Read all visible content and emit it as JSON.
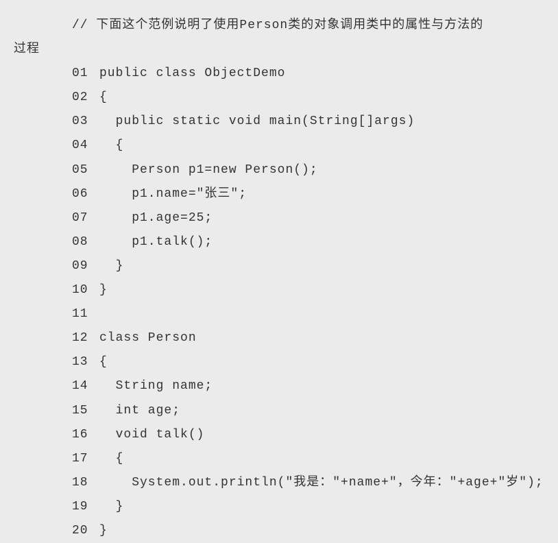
{
  "comment": {
    "line1": "// 下面这个范例说明了使用Person类的对象调用类中的属性与方法的",
    "line2": "过程"
  },
  "lines": [
    {
      "num": "01",
      "code": "public class ObjectDemo"
    },
    {
      "num": "02",
      "code": "{"
    },
    {
      "num": "",
      "code": ""
    },
    {
      "num": "03",
      "code": "  public static void main(String[]args)"
    },
    {
      "num": "04",
      "code": "  {"
    },
    {
      "num": "05",
      "code": "    Person p1=new Person();"
    },
    {
      "num": "06",
      "code": "    p1.name=\"张三\";"
    },
    {
      "num": "07",
      "code": "    p1.age=25;"
    },
    {
      "num": "08",
      "code": "    p1.talk();"
    },
    {
      "num": "09",
      "code": "  }"
    },
    {
      "num": "10",
      "code": "}"
    },
    {
      "num": "11",
      "code": ""
    },
    {
      "num": "12",
      "code": "class Person"
    },
    {
      "num": "13",
      "code": "{"
    },
    {
      "num": "14",
      "code": "  String name;"
    },
    {
      "num": "15",
      "code": "  int age;"
    },
    {
      "num": "16",
      "code": "  void talk()"
    },
    {
      "num": "17",
      "code": "  {"
    },
    {
      "num": "18",
      "code": "    System.out.println(\"我是：\"+name+\"，今年：\"+age+\"岁\");"
    },
    {
      "num": "19",
      "code": "  }"
    },
    {
      "num": "20",
      "code": "}"
    }
  ]
}
